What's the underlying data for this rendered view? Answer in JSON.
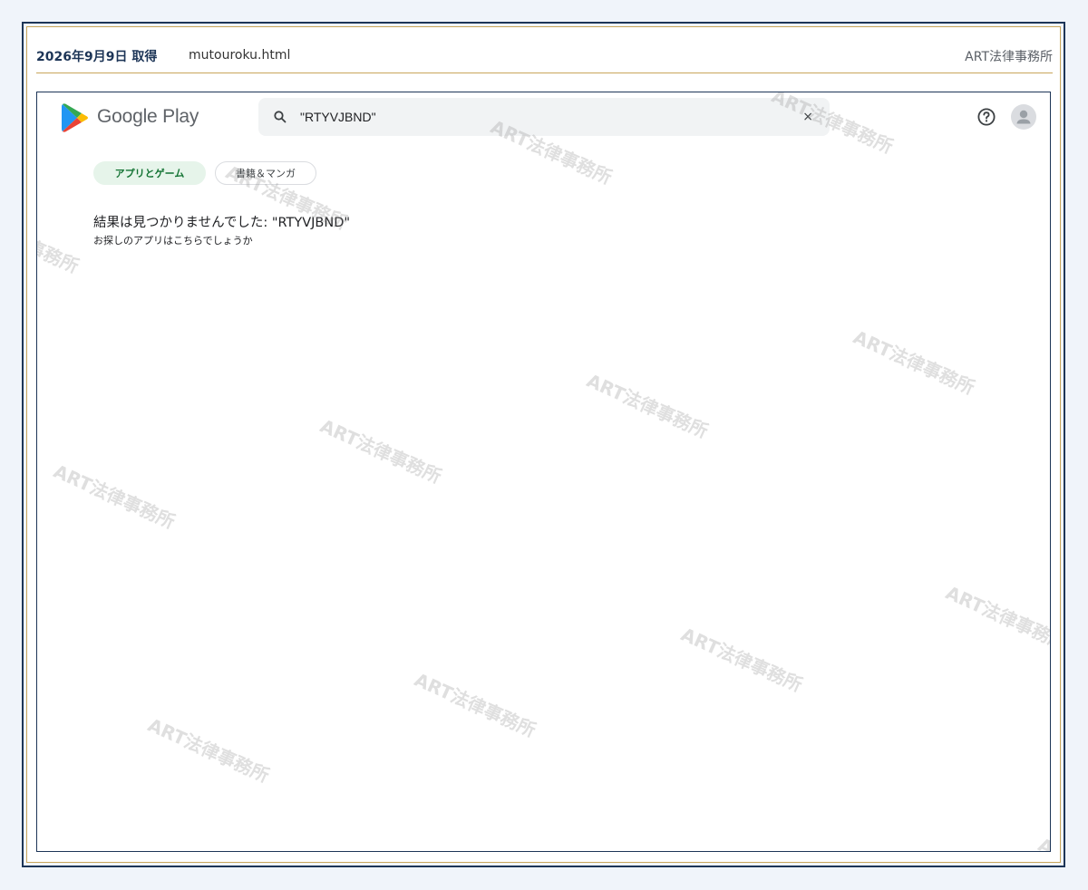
{
  "capture": {
    "date": "2026年9月9日 取得",
    "file": "mutouroku.html",
    "firm": "ART法律事務所"
  },
  "store": {
    "brand": "Google Play",
    "search": {
      "value": "\"RTYVJBND\"",
      "clear_label": "×"
    },
    "chips": [
      {
        "label": "アプリとゲーム",
        "selected": true
      },
      {
        "label": "書籍＆マンガ",
        "selected": false
      }
    ],
    "result": {
      "title": "結果は見つかりませんでした: \"RTYVJBND\"",
      "subtitle": "お探しのアプリはこちらでしょうか"
    }
  },
  "watermark": {
    "text": "ART法律事務所"
  },
  "colors": {
    "frame": "#1d3557",
    "gold_rule": "#c9a55a",
    "page_bg": "#f0f4fa",
    "chip_selected_bg": "#e6f4ea",
    "chip_selected_text": "#137333"
  },
  "icons": {
    "logo": "google-play-logo",
    "search": "search-icon",
    "help": "help-icon",
    "account": "account-avatar-icon"
  }
}
